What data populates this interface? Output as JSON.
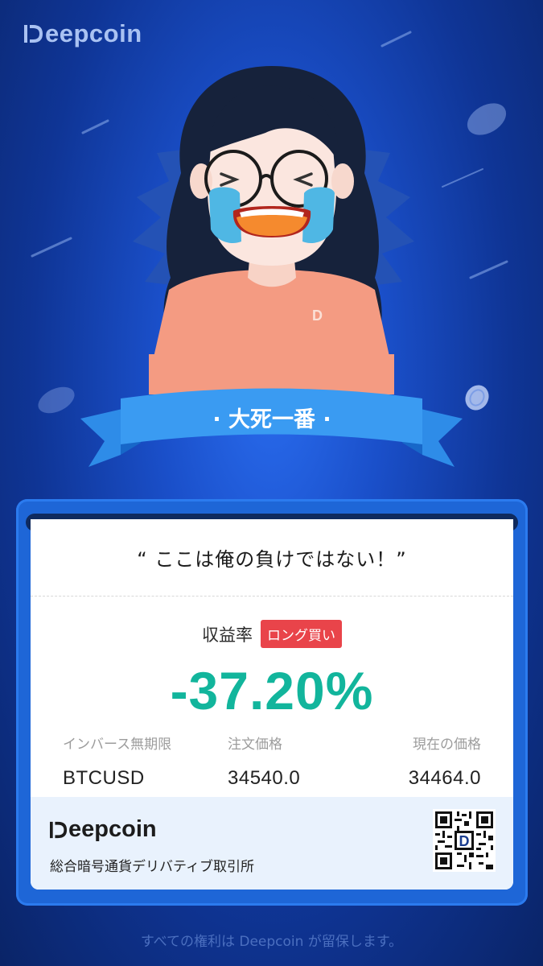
{
  "brand": {
    "name": "Deepcoin",
    "name_rest": "eepcoin"
  },
  "hero": {
    "ribbon_text": "· 大死一番 ·",
    "shirt_logo": "D"
  },
  "card": {
    "quote": "“ ここは俺の負けではない！”",
    "pnl_label": "収益率",
    "direction_badge": "ロング買い",
    "pnl_value": "-37.20%",
    "columns": [
      {
        "label": "インバース無期限",
        "value": "BTCUSD"
      },
      {
        "label": "注文価格",
        "value": "34540.0"
      },
      {
        "label": "現在の価格",
        "value": "34464.0"
      }
    ],
    "footer": {
      "brand": "Deepcoin",
      "brand_rest": "eepcoin",
      "tagline": "総合暗号通貨デリバティブ取引所",
      "qr_logo": "D"
    }
  },
  "copyright": "すべての権利は Deepcoin が留保します。",
  "colors": {
    "profit_negative": "#12b59c",
    "badge": "#e9444a",
    "background": "#1a4fc9"
  },
  "icons": [
    "deepcoin-logo-icon",
    "qr-code-icon"
  ]
}
